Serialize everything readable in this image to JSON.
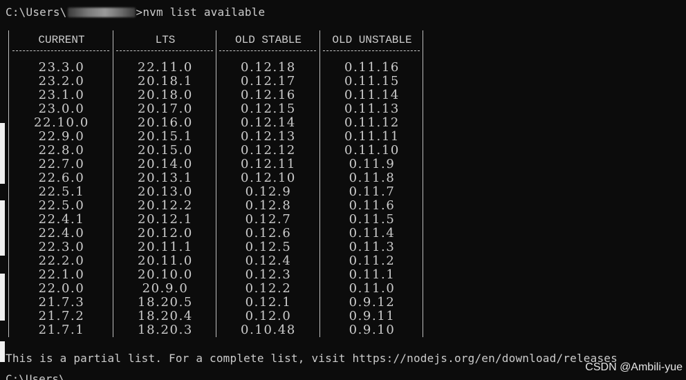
{
  "prompt": {
    "path_prefix": "C:\\Users\\",
    "path_suffix": ">",
    "command": "nvm list available"
  },
  "table": {
    "columns": [
      "CURRENT",
      "LTS",
      "OLD STABLE",
      "OLD UNSTABLE"
    ],
    "separator": "--------------",
    "rows": [
      [
        "23.3.0",
        "22.11.0",
        "0.12.18",
        "0.11.16"
      ],
      [
        "23.2.0",
        "20.18.1",
        "0.12.17",
        "0.11.15"
      ],
      [
        "23.1.0",
        "20.18.0",
        "0.12.16",
        "0.11.14"
      ],
      [
        "23.0.0",
        "20.17.0",
        "0.12.15",
        "0.11.13"
      ],
      [
        "22.10.0",
        "20.16.0",
        "0.12.14",
        "0.11.12"
      ],
      [
        "22.9.0",
        "20.15.1",
        "0.12.13",
        "0.11.11"
      ],
      [
        "22.8.0",
        "20.15.0",
        "0.12.12",
        "0.11.10"
      ],
      [
        "22.7.0",
        "20.14.0",
        "0.12.11",
        "0.11.9"
      ],
      [
        "22.6.0",
        "20.13.1",
        "0.12.10",
        "0.11.8"
      ],
      [
        "22.5.1",
        "20.13.0",
        "0.12.9",
        "0.11.7"
      ],
      [
        "22.5.0",
        "20.12.2",
        "0.12.8",
        "0.11.6"
      ],
      [
        "22.4.1",
        "20.12.1",
        "0.12.7",
        "0.11.5"
      ],
      [
        "22.4.0",
        "20.12.0",
        "0.12.6",
        "0.11.4"
      ],
      [
        "22.3.0",
        "20.11.1",
        "0.12.5",
        "0.11.3"
      ],
      [
        "22.2.0",
        "20.11.0",
        "0.12.4",
        "0.11.2"
      ],
      [
        "22.1.0",
        "20.10.0",
        "0.12.3",
        "0.11.1"
      ],
      [
        "22.0.0",
        "20.9.0",
        "0.12.2",
        "0.11.0"
      ],
      [
        "21.7.3",
        "18.20.5",
        "0.12.1",
        "0.9.12"
      ],
      [
        "21.7.2",
        "18.20.4",
        "0.12.0",
        "0.9.11"
      ],
      [
        "21.7.1",
        "18.20.3",
        "0.10.48",
        "0.9.10"
      ]
    ]
  },
  "footer_text": "This is a partial list. For a complete list, visit https://nodejs.org/en/download/releases",
  "bottom_partial_text": "C:\\Users\\",
  "watermark": "CSDN @Ambili-yue",
  "colors": {
    "background": "#0c0c0c",
    "text": "#cccccc"
  }
}
